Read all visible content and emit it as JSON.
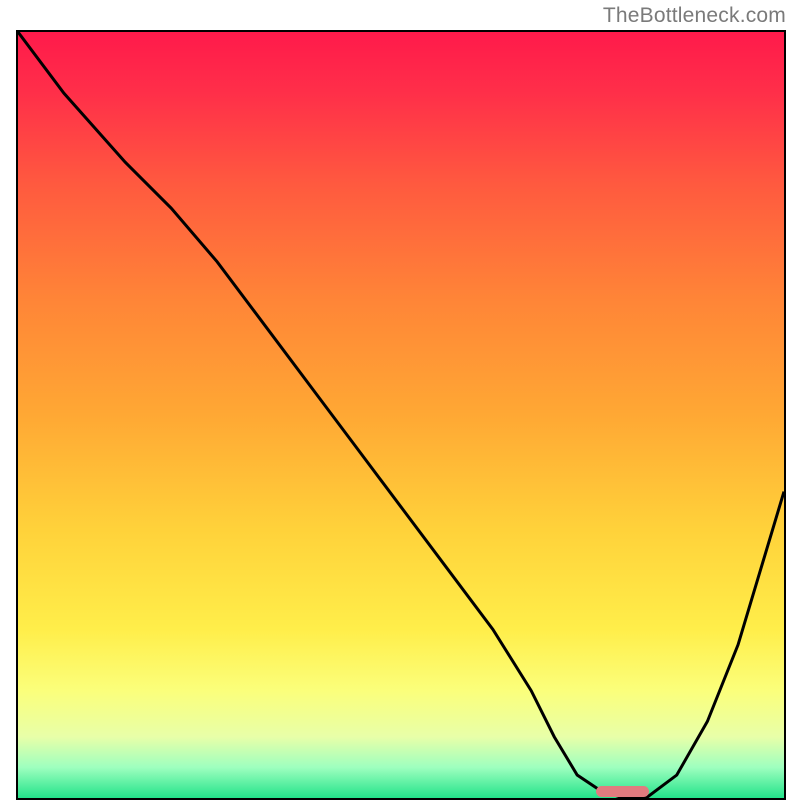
{
  "watermark": "TheBottleneck.com",
  "colors": {
    "gradient_stops": [
      {
        "offset": 0.0,
        "color": "#ff1a4b"
      },
      {
        "offset": 0.08,
        "color": "#ff2f49"
      },
      {
        "offset": 0.2,
        "color": "#ff5a3f"
      },
      {
        "offset": 0.35,
        "color": "#ff8537"
      },
      {
        "offset": 0.5,
        "color": "#ffa834"
      },
      {
        "offset": 0.65,
        "color": "#ffd23a"
      },
      {
        "offset": 0.78,
        "color": "#ffee4a"
      },
      {
        "offset": 0.86,
        "color": "#fbff7b"
      },
      {
        "offset": 0.92,
        "color": "#e8ffa8"
      },
      {
        "offset": 0.96,
        "color": "#9effbf"
      },
      {
        "offset": 1.0,
        "color": "#23e38a"
      }
    ],
    "curve": "#000000",
    "marker": "#e17b7f",
    "border": "#000000"
  },
  "chart_data": {
    "type": "line",
    "title": "",
    "xlabel": "",
    "ylabel": "",
    "xlim": [
      0,
      100
    ],
    "ylim": [
      0,
      100
    ],
    "series": [
      {
        "name": "bottleneck-curve",
        "x": [
          0,
          6,
          14,
          20,
          26,
          32,
          38,
          44,
          50,
          56,
          62,
          67,
          70,
          73,
          76,
          79,
          82,
          86,
          90,
          94,
          100
        ],
        "values": [
          100,
          92,
          83,
          77,
          70,
          62,
          54,
          46,
          38,
          30,
          22,
          14,
          8,
          3,
          1,
          0,
          0,
          3,
          10,
          20,
          40
        ]
      }
    ],
    "marker": {
      "x_start": 75,
      "x_end": 82,
      "y": 0
    }
  }
}
